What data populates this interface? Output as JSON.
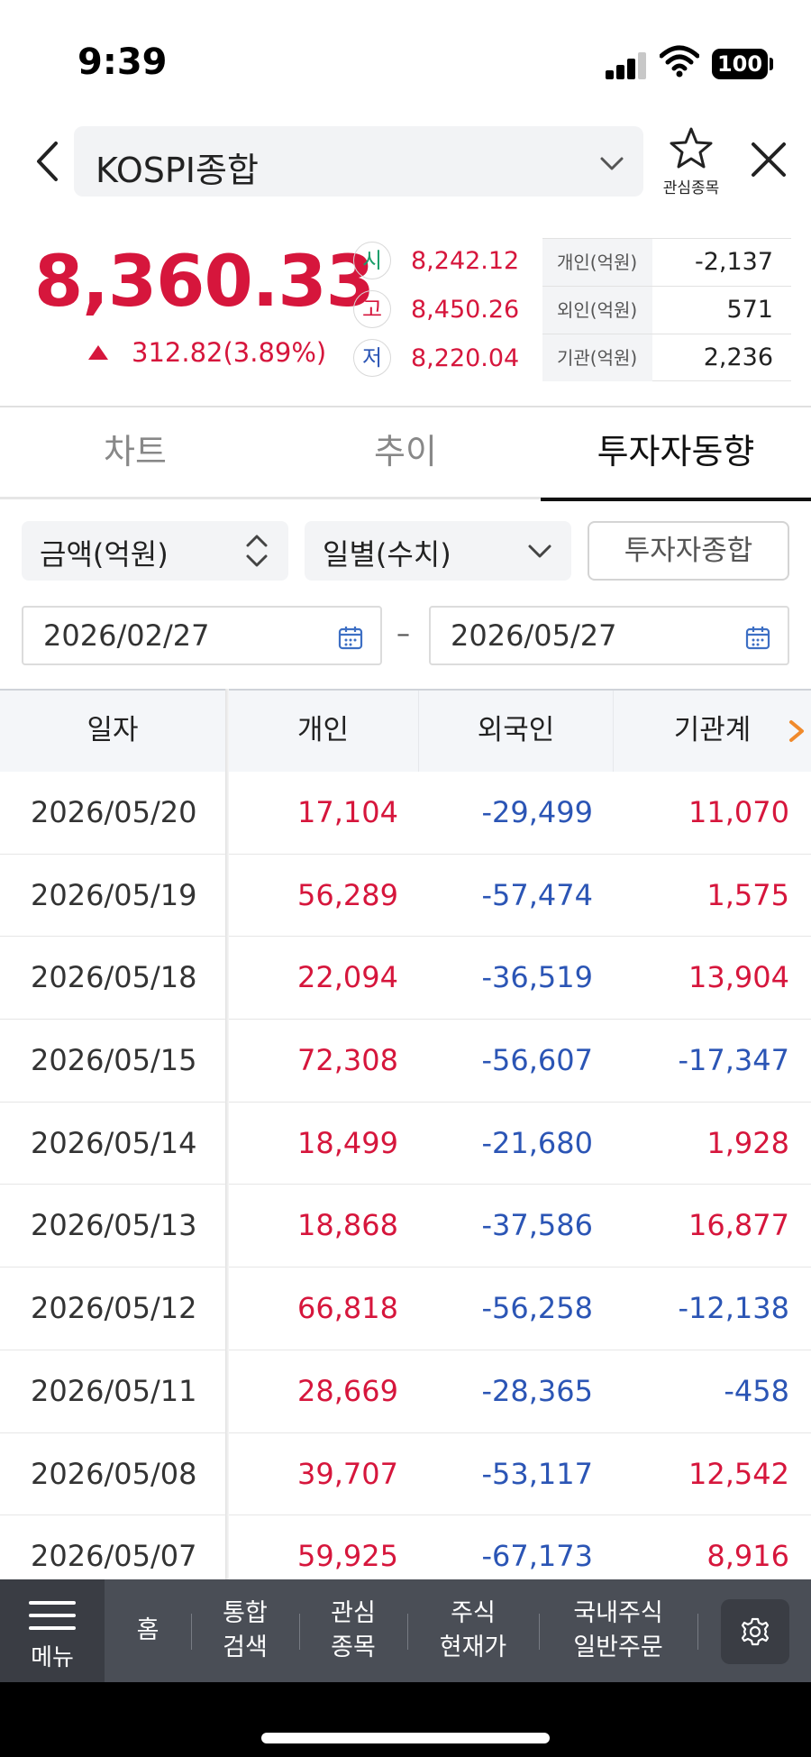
{
  "status": {
    "time": "9:39",
    "battery": "100"
  },
  "header": {
    "title": "KOSPI종합",
    "fav_label": "관심종목"
  },
  "summary": {
    "price": "8,360.33",
    "change": "312.82(3.89%)",
    "direction": "up",
    "ohlc": [
      {
        "label": "시",
        "value": "8,242.12",
        "color": "#1a9e6a"
      },
      {
        "label": "고",
        "value": "8,450.26",
        "color": "#d6163c"
      },
      {
        "label": "저",
        "value": "8,220.04",
        "color": "#2b55b5"
      }
    ],
    "investors": [
      {
        "label": "개인(억원)",
        "value": "-2,137"
      },
      {
        "label": "외인(억원)",
        "value": "571"
      },
      {
        "label": "기관(억원)",
        "value": "2,236"
      }
    ]
  },
  "tabs": [
    {
      "label": "차트",
      "active": false
    },
    {
      "label": "추이",
      "active": false
    },
    {
      "label": "투자자동향",
      "active": true
    }
  ],
  "filters": {
    "unit": "금액(억원)",
    "period": "일별(수치)",
    "summary_button": "투자자종합",
    "start_date": "2026/02/27",
    "end_date": "2026/05/27",
    "separator": "–"
  },
  "table": {
    "columns": [
      "일자",
      "개인",
      "외국인",
      "기관계"
    ],
    "rows": [
      {
        "date": "2026/05/20",
        "individual": "17,104",
        "foreign": "-29,499",
        "institution": "11,070"
      },
      {
        "date": "2026/05/19",
        "individual": "56,289",
        "foreign": "-57,474",
        "institution": "1,575"
      },
      {
        "date": "2026/05/18",
        "individual": "22,094",
        "foreign": "-36,519",
        "institution": "13,904"
      },
      {
        "date": "2026/05/15",
        "individual": "72,308",
        "foreign": "-56,607",
        "institution": "-17,347"
      },
      {
        "date": "2026/05/14",
        "individual": "18,499",
        "foreign": "-21,680",
        "institution": "1,928"
      },
      {
        "date": "2026/05/13",
        "individual": "18,868",
        "foreign": "-37,586",
        "institution": "16,877"
      },
      {
        "date": "2026/05/12",
        "individual": "66,818",
        "foreign": "-56,258",
        "institution": "-12,138"
      },
      {
        "date": "2026/05/11",
        "individual": "28,669",
        "foreign": "-28,365",
        "institution": "-458"
      },
      {
        "date": "2026/05/08",
        "individual": "39,707",
        "foreign": "-53,117",
        "institution": "12,542"
      },
      {
        "date": "2026/05/07",
        "individual": "59,925",
        "foreign": "-67,173",
        "institution": "8,916"
      }
    ]
  },
  "bottom_nav": {
    "menu_label": "메뉴",
    "items": [
      {
        "line1": "홈",
        "line2": ""
      },
      {
        "line1": "통합",
        "line2": "검색"
      },
      {
        "line1": "관심",
        "line2": "종목"
      },
      {
        "line1": "주식",
        "line2": "현재가"
      },
      {
        "line1": "국내주식",
        "line2": "일반주문"
      }
    ],
    "settings_icon": "gear-icon"
  },
  "colors": {
    "up": "#d6163c",
    "down": "#2b55b5",
    "accent_orange": "#f08a2c"
  }
}
